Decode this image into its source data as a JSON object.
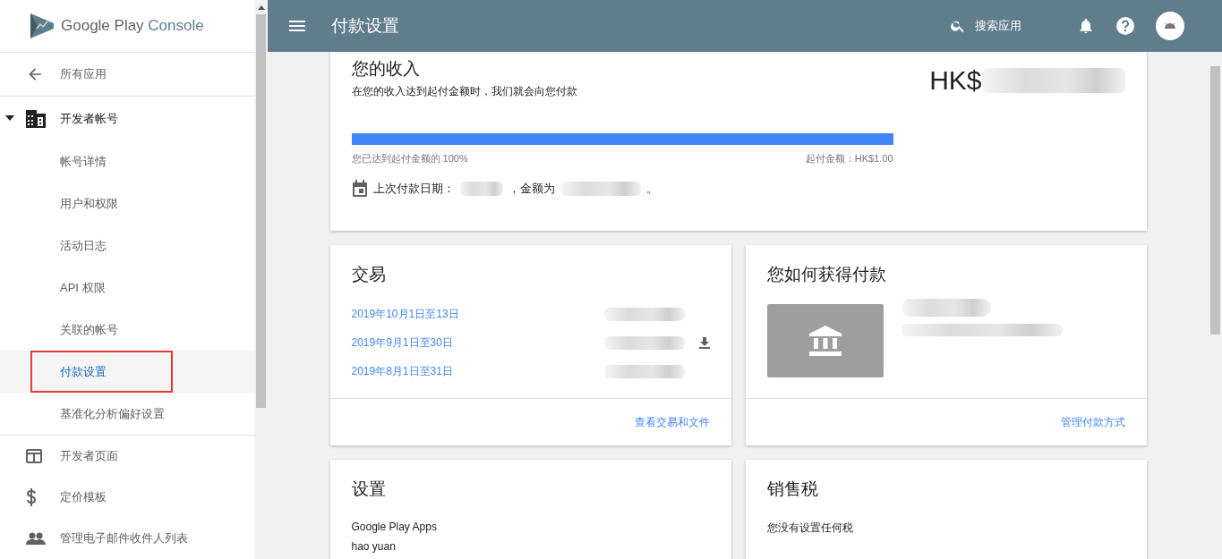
{
  "logo": {
    "brand": "Google Play",
    "product": "Console"
  },
  "sidebar": {
    "items": [
      {
        "kind": "back",
        "label": "所有应用"
      },
      {
        "kind": "section",
        "label": "开发者帐号",
        "expanded": true,
        "children": [
          {
            "label": "帐号详情",
            "selected": false,
            "outlined": false
          },
          {
            "label": "用户和权限",
            "selected": false,
            "outlined": false
          },
          {
            "label": "活动日志",
            "selected": false,
            "outlined": false
          },
          {
            "label": "API 权限",
            "selected": false,
            "outlined": false
          },
          {
            "label": "关联的帐号",
            "selected": false,
            "outlined": false
          },
          {
            "label": "付款设置",
            "selected": true,
            "outlined": true
          },
          {
            "label": "基准化分析偏好设置",
            "selected": false,
            "outlined": false
          }
        ]
      },
      {
        "kind": "page",
        "label": "开发者页面"
      },
      {
        "kind": "pricing",
        "label": "定价模板"
      },
      {
        "kind": "mailing",
        "label": "管理电子邮件收件人列表"
      }
    ]
  },
  "topbar": {
    "title": "付款设置",
    "search": "搜索应用"
  },
  "earnings": {
    "title": "您的收入",
    "subtitle": "在您的收入达到起付金额时，我们就会向您付款",
    "amount_prefix": "HK$",
    "level": 1.0,
    "progress_label": "您已达到起付金额的 100%",
    "threshold": "起付金额：HK$1.00",
    "last_payment_label": "上次付款日期：",
    "amount_label": "，金额为",
    "end_mark": "。"
  },
  "transactions": {
    "title": "交易",
    "rows": [
      {
        "period": "2019年10月1日至13日",
        "downloadable": false
      },
      {
        "period": "2019年9月1日至30日",
        "downloadable": true
      },
      {
        "period": "2019年8月1日至31日",
        "downloadable": false
      }
    ],
    "footer_link": "查看交易和文件"
  },
  "payment_method": {
    "title": "您如何获得付款",
    "footer_link": "管理付款方式"
  },
  "settings": {
    "title": "设置",
    "lines": [
      "Google Play Apps",
      "hao yuan"
    ]
  },
  "sales_tax": {
    "title": "销售税",
    "text": "您没有设置任何税"
  }
}
